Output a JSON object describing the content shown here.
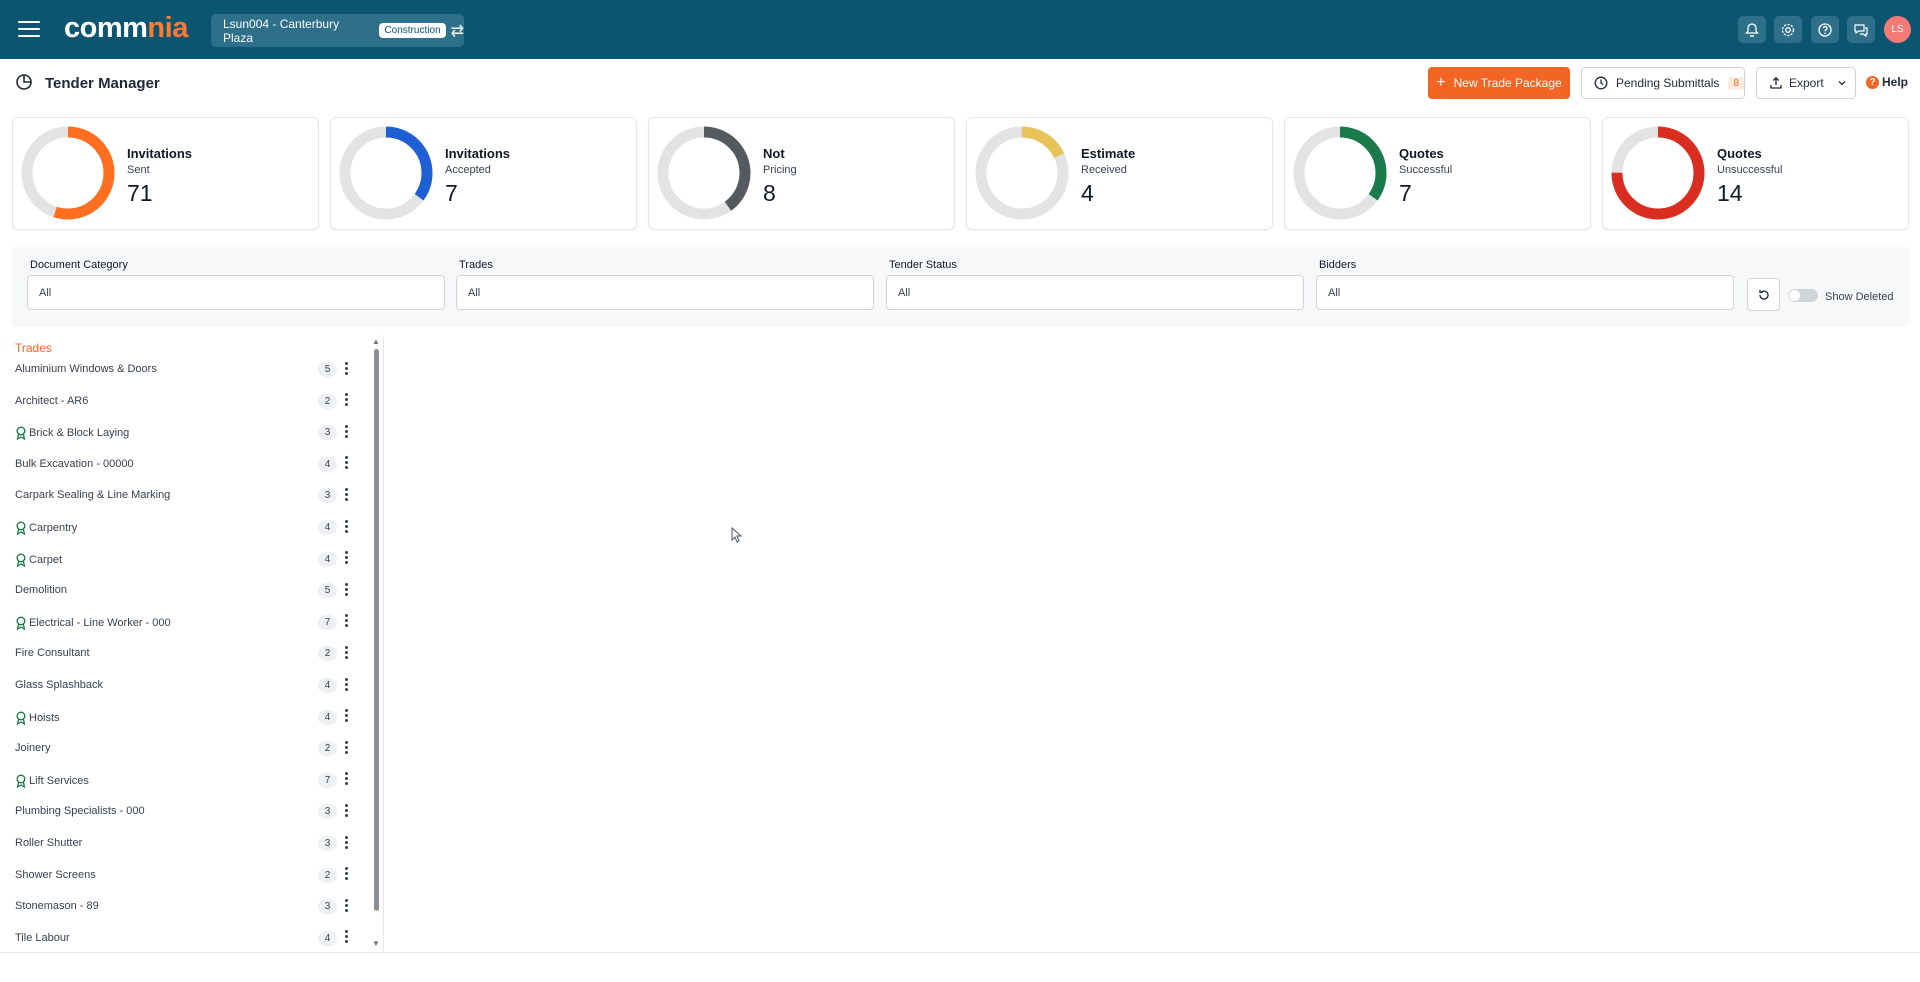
{
  "topbar": {
    "logo_part1": "comm",
    "logo_part2": "nia",
    "project_name": "Lsun004 - Canterbury Plaza",
    "project_badge": "Construction",
    "avatar_initials": "LS"
  },
  "header": {
    "title": "Tender Manager",
    "new_trade_label": "New Trade Package",
    "pending_label": "Pending Submittals",
    "pending_count": "8",
    "export_label": "Export",
    "help_label": "Help"
  },
  "stats": [
    {
      "title": "Invitations",
      "subtitle": "Sent",
      "value": "71",
      "color": "#ff6f1f",
      "fraction": 0.55
    },
    {
      "title": "Invitations",
      "subtitle": "Accepted",
      "value": "7",
      "color": "#1f5fd6",
      "fraction": 0.35
    },
    {
      "title": "Not",
      "subtitle": "Pricing",
      "value": "8",
      "color": "#555a60",
      "fraction": 0.4
    },
    {
      "title": "Estimate",
      "subtitle": "Received",
      "value": "4",
      "color": "#e8c35a",
      "fraction": 0.18
    },
    {
      "title": "Quotes",
      "subtitle": "Successful",
      "value": "7",
      "color": "#1a7a4c",
      "fraction": 0.35
    },
    {
      "title": "Quotes",
      "subtitle": "Unsuccessful",
      "value": "14",
      "color": "#d92d20",
      "fraction": 0.75
    }
  ],
  "filters": [
    {
      "label": "Document Category",
      "value": "All"
    },
    {
      "label": "Trades",
      "value": "All"
    },
    {
      "label": "Tender Status",
      "value": "All"
    },
    {
      "label": "Bidders",
      "value": "All"
    }
  ],
  "show_deleted_label": "Show Deleted",
  "trades": {
    "heading": "Trades",
    "items": [
      {
        "name": "Aluminium Windows & Doors",
        "count": "5",
        "awarded": false
      },
      {
        "name": "Architect - AR6",
        "count": "2",
        "awarded": false
      },
      {
        "name": "Brick & Block Laying",
        "count": "3",
        "awarded": true
      },
      {
        "name": "Bulk Excavation - 00000",
        "count": "4",
        "awarded": false
      },
      {
        "name": "Carpark Sealing & Line Marking",
        "count": "3",
        "awarded": false
      },
      {
        "name": "Carpentry",
        "count": "4",
        "awarded": true
      },
      {
        "name": "Carpet",
        "count": "4",
        "awarded": true
      },
      {
        "name": "Demolition",
        "count": "5",
        "awarded": false
      },
      {
        "name": "Electrical - Line Worker - 000",
        "count": "7",
        "awarded": true
      },
      {
        "name": "Fire Consultant",
        "count": "2",
        "awarded": false
      },
      {
        "name": "Glass Splashback",
        "count": "4",
        "awarded": false
      },
      {
        "name": "Hoists",
        "count": "4",
        "awarded": true
      },
      {
        "name": "Joinery",
        "count": "2",
        "awarded": false
      },
      {
        "name": "Lift Services",
        "count": "7",
        "awarded": true
      },
      {
        "name": "Plumbing Specialists - 000",
        "count": "3",
        "awarded": false
      },
      {
        "name": "Roller Shutter",
        "count": "3",
        "awarded": false
      },
      {
        "name": "Shower Screens",
        "count": "2",
        "awarded": false
      },
      {
        "name": "Stonemason - 89",
        "count": "3",
        "awarded": false
      },
      {
        "name": "Tile Labour",
        "count": "4",
        "awarded": false
      }
    ]
  }
}
